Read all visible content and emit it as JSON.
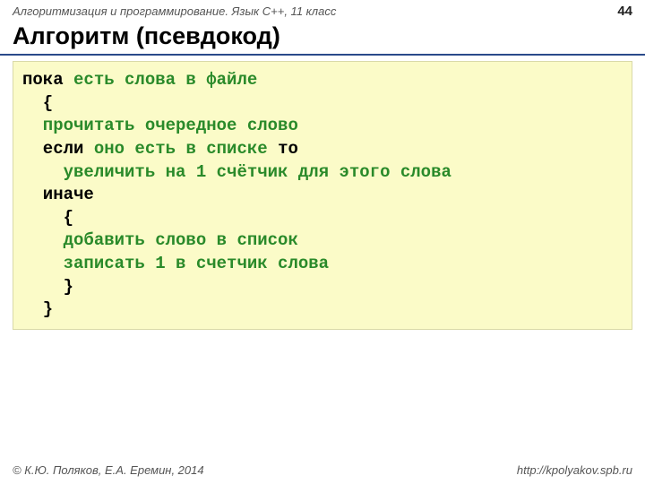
{
  "header": {
    "course": "Алгоритмизация и программирование. Язык C++, 11 класс",
    "pagenum": "44"
  },
  "title": "Алгоритм (псевдокод)",
  "code": {
    "l1a": "пока",
    "l1b": " есть слова в файле",
    "l2": "  {",
    "l3": "  прочитать очередное слово",
    "l4a": "  если ",
    "l4b": "оно есть в списке ",
    "l4c": "то",
    "l5": "    увеличить на 1 счётчик для этого слова",
    "l6": "  иначе",
    "l7": "    {",
    "l8": "    добавить слово в список",
    "l9": "    записать 1 в счетчик слова",
    "l10": "    }",
    "l11": "  }"
  },
  "footer": {
    "left": "© К.Ю. Поляков, Е.А. Еремин, 2014",
    "right": "http://kpolyakov.spb.ru"
  }
}
